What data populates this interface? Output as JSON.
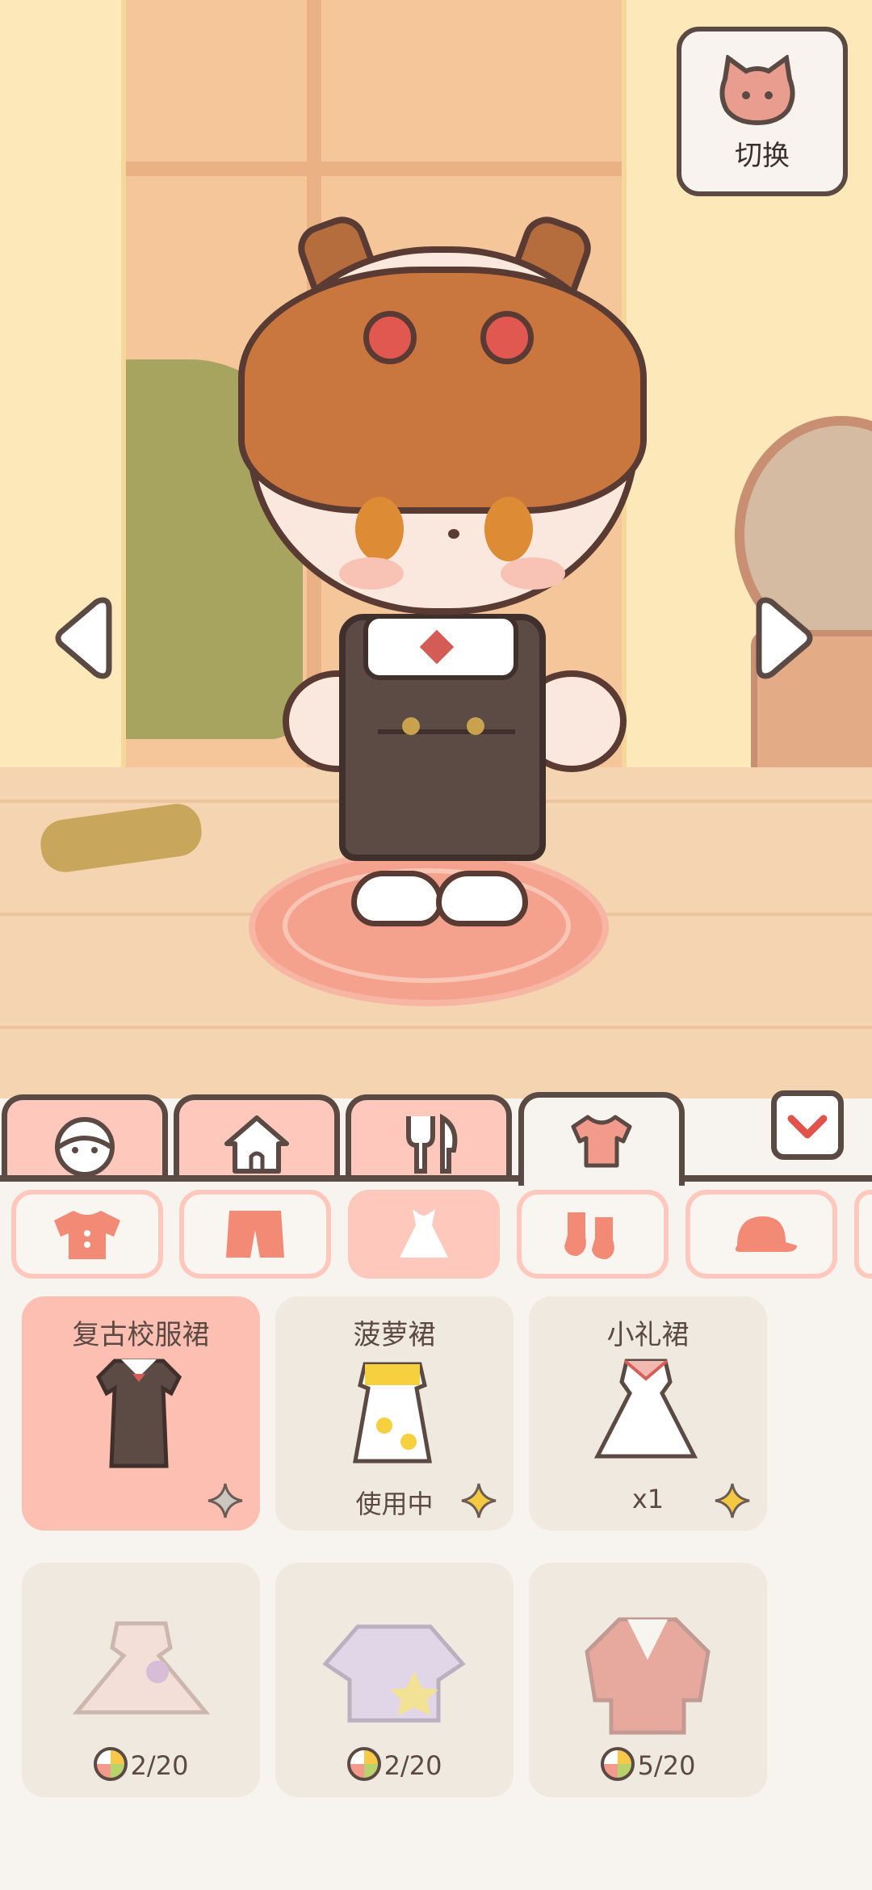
{
  "switch_button": {
    "label": "切换",
    "icon": "cat-face-icon"
  },
  "nav": {
    "left_arrow": "left-arrow-icon",
    "right_arrow": "right-arrow-icon"
  },
  "tabs": [
    {
      "icon": "face-icon",
      "active": false
    },
    {
      "icon": "house-icon",
      "active": false
    },
    {
      "icon": "cutlery-icon",
      "active": false
    },
    {
      "icon": "shirt-icon",
      "active": true
    }
  ],
  "collapse": {
    "icon": "chevron-down-icon"
  },
  "categories": [
    {
      "icon": "top-icon",
      "active": false
    },
    {
      "icon": "shorts-icon",
      "active": false
    },
    {
      "icon": "dress-icon",
      "active": true
    },
    {
      "icon": "socks-icon",
      "active": false
    },
    {
      "icon": "hat-icon",
      "active": false
    }
  ],
  "items": [
    {
      "name": "复古校服裙",
      "status": "",
      "selected": true
    },
    {
      "name": "菠萝裙",
      "status": "使用中",
      "selected": false
    },
    {
      "name": "小礼裙",
      "status": "x1",
      "selected": false
    }
  ],
  "locked_items": [
    {
      "price": "2/20"
    },
    {
      "price": "2/20"
    },
    {
      "price": "5/20"
    }
  ],
  "colors": {
    "accent": "#fec8bd",
    "outline": "#5b4a44",
    "background": "#f7f3ee",
    "selected_card": "#fdbfb2"
  }
}
